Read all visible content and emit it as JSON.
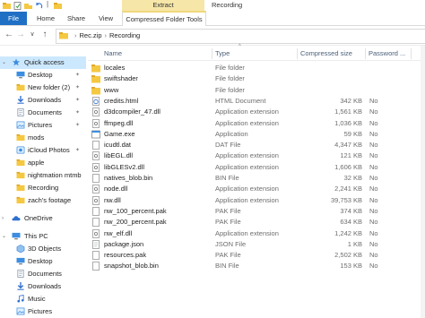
{
  "ribbon": {
    "file_tab": "File",
    "tabs": [
      "Home",
      "Share",
      "View"
    ],
    "context_group": "Extract",
    "context_tab": "Compressed Folder Tools",
    "window_title": "Recording"
  },
  "address": {
    "crumbs": [
      "Rec.zip",
      "Recording"
    ]
  },
  "nav": {
    "items": [
      {
        "label": "Quick access",
        "icon": "star-icon",
        "pinned": false,
        "selected": true
      },
      {
        "label": "Desktop",
        "icon": "desktop-icon",
        "pinned": true
      },
      {
        "label": "New folder (2)",
        "icon": "folder-icon",
        "pinned": true
      },
      {
        "label": "Downloads",
        "icon": "download-icon",
        "pinned": true
      },
      {
        "label": "Documents",
        "icon": "documents-icon",
        "pinned": true
      },
      {
        "label": "Pictures",
        "icon": "pictures-icon",
        "pinned": true
      },
      {
        "label": "mods",
        "icon": "folder-icon",
        "pinned": false
      },
      {
        "label": "iCloud Photos",
        "icon": "cloud-icon",
        "pinned": true
      },
      {
        "label": "apple",
        "icon": "folder-icon",
        "pinned": false
      },
      {
        "label": "nightmation mtmb",
        "icon": "folder-icon",
        "pinned": false
      },
      {
        "label": "Recording",
        "icon": "folder-icon",
        "pinned": false
      },
      {
        "label": "zach's footage",
        "icon": "folder-icon",
        "pinned": false
      },
      {
        "label": "OneDrive",
        "icon": "onedrive-icon",
        "pinned": false
      },
      {
        "label": "This PC",
        "icon": "pc-icon",
        "pinned": false
      },
      {
        "label": "3D Objects",
        "icon": "cube-icon",
        "pinned": false
      },
      {
        "label": "Desktop",
        "icon": "desktop-icon",
        "pinned": false
      },
      {
        "label": "Documents",
        "icon": "documents-icon",
        "pinned": false
      },
      {
        "label": "Downloads",
        "icon": "download-icon",
        "pinned": false
      },
      {
        "label": "Music",
        "icon": "music-icon",
        "pinned": false
      },
      {
        "label": "Pictures",
        "icon": "pictures-icon",
        "pinned": false
      }
    ]
  },
  "columns": {
    "name": "Name",
    "type": "Type",
    "size": "Compressed size",
    "password": "Password ..."
  },
  "files": [
    {
      "name": "locales",
      "type": "File folder",
      "size": "",
      "pw": "",
      "icon": "folder-icon"
    },
    {
      "name": "swiftshader",
      "type": "File folder",
      "size": "",
      "pw": "",
      "icon": "folder-icon"
    },
    {
      "name": "www",
      "type": "File folder",
      "size": "",
      "pw": "",
      "icon": "folder-icon"
    },
    {
      "name": "credits.html",
      "type": "HTML Document",
      "size": "342 KB",
      "pw": "No",
      "icon": "html-file-icon"
    },
    {
      "name": "d3dcompiler_47.dll",
      "type": "Application extension",
      "size": "1,561 KB",
      "pw": "No",
      "icon": "dll-file-icon"
    },
    {
      "name": "ffmpeg.dll",
      "type": "Application extension",
      "size": "1,036 KB",
      "pw": "No",
      "icon": "dll-file-icon"
    },
    {
      "name": "Game.exe",
      "type": "Application",
      "size": "59 KB",
      "pw": "No",
      "icon": "exe-file-icon"
    },
    {
      "name": "icudtl.dat",
      "type": "DAT File",
      "size": "4,347 KB",
      "pw": "No",
      "icon": "generic-file-icon"
    },
    {
      "name": "libEGL.dll",
      "type": "Application extension",
      "size": "121 KB",
      "pw": "No",
      "icon": "dll-file-icon"
    },
    {
      "name": "libGLESv2.dll",
      "type": "Application extension",
      "size": "1,606 KB",
      "pw": "No",
      "icon": "dll-file-icon"
    },
    {
      "name": "natives_blob.bin",
      "type": "BIN File",
      "size": "32 KB",
      "pw": "No",
      "icon": "generic-file-icon"
    },
    {
      "name": "node.dll",
      "type": "Application extension",
      "size": "2,241 KB",
      "pw": "No",
      "icon": "dll-file-icon"
    },
    {
      "name": "nw.dll",
      "type": "Application extension",
      "size": "39,753 KB",
      "pw": "No",
      "icon": "dll-file-icon"
    },
    {
      "name": "nw_100_percent.pak",
      "type": "PAK File",
      "size": "374 KB",
      "pw": "No",
      "icon": "generic-file-icon"
    },
    {
      "name": "nw_200_percent.pak",
      "type": "PAK File",
      "size": "634 KB",
      "pw": "No",
      "icon": "generic-file-icon"
    },
    {
      "name": "nw_elf.dll",
      "type": "Application extension",
      "size": "1,242 KB",
      "pw": "No",
      "icon": "dll-file-icon"
    },
    {
      "name": "package.json",
      "type": "JSON File",
      "size": "1 KB",
      "pw": "No",
      "icon": "json-file-icon"
    },
    {
      "name": "resources.pak",
      "type": "PAK File",
      "size": "2,502 KB",
      "pw": "No",
      "icon": "generic-file-icon"
    },
    {
      "name": "snapshot_blob.bin",
      "type": "BIN File",
      "size": "153 KB",
      "pw": "No",
      "icon": "generic-file-icon"
    }
  ],
  "colors": {
    "accent": "#1f6fc5",
    "context_highlight": "#f6e7a8",
    "selection": "#cce8ff",
    "folder": "#f5c842"
  }
}
